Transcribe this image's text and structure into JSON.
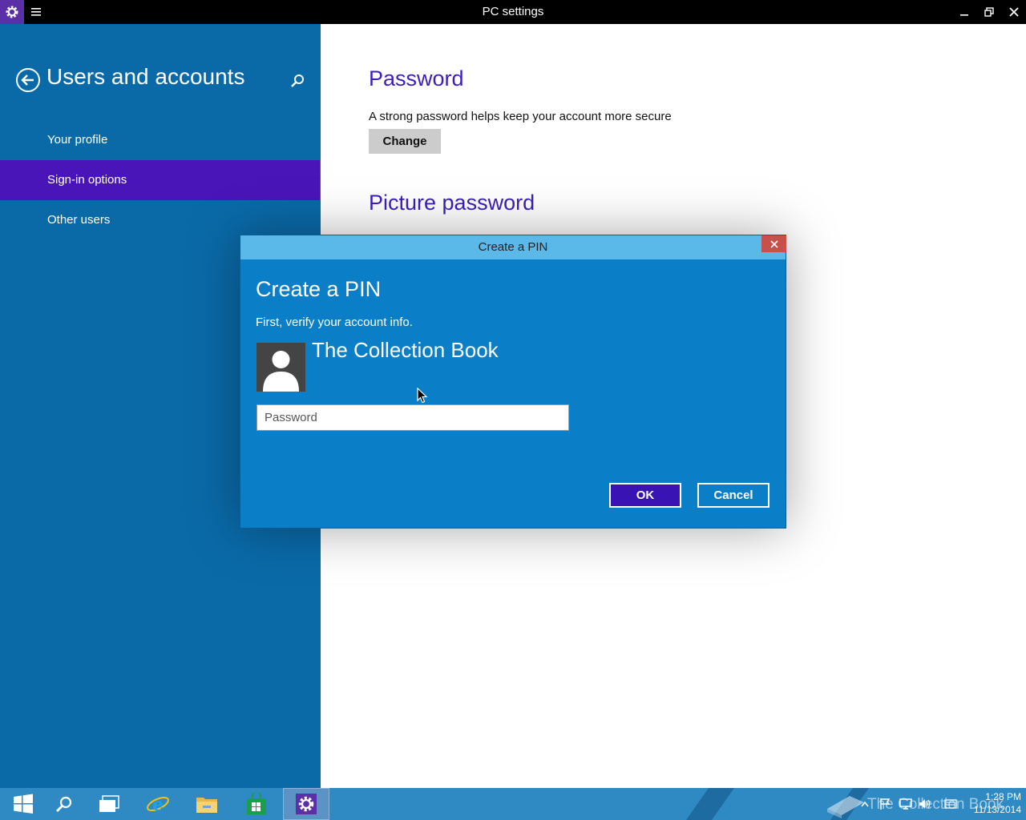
{
  "window": {
    "title": "PC settings",
    "app_icon": "gear-icon",
    "menu_icon": "hamburger-icon",
    "controls": [
      "minimize-icon",
      "restore-icon",
      "close-icon"
    ]
  },
  "left_pane": {
    "title": "Users and accounts",
    "back_icon": "back-arrow-icon",
    "search_icon": "search-icon",
    "items": [
      {
        "label": "Your profile",
        "selected": false
      },
      {
        "label": "Sign-in options",
        "selected": true
      },
      {
        "label": "Other users",
        "selected": false
      }
    ]
  },
  "content": {
    "password": {
      "heading": "Password",
      "description": "A strong password helps keep your account more secure",
      "button_label": "Change"
    },
    "picture_password": {
      "heading": "Picture password"
    }
  },
  "dialog": {
    "title": "Create a PIN",
    "heading": "Create a PIN",
    "subtitle": "First, verify your account info.",
    "account_name": "The Collection Book",
    "password_placeholder": "Password",
    "password_value": "",
    "ok_label": "OK",
    "cancel_label": "Cancel"
  },
  "taskbar": {
    "apps": [
      "start-icon",
      "search-icon",
      "task-view-icon",
      "internet-explorer-icon",
      "file-explorer-icon",
      "store-icon",
      "settings-icon"
    ],
    "active_app": "settings-icon",
    "watermark": "The Collection Book",
    "tray_icons": [
      "show-hidden-icons-chevron-icon",
      "action-center-flag-icon",
      "network-icon",
      "volume-icon",
      "keyboard-icon"
    ],
    "time": "1:28 PM",
    "date": "11/13/2014"
  },
  "colors": {
    "nav_pane": "#0a6aa8",
    "nav_selected": "#4a15b8",
    "heading_accent": "#3b1fb8",
    "dialog_body": "#0a7fc7",
    "dialog_titlebar": "#5ab9e8",
    "dialog_close": "#c7504a",
    "ok_button": "#3a13b5",
    "taskbar": "#2f8ac4",
    "titlebar": "#000000"
  }
}
